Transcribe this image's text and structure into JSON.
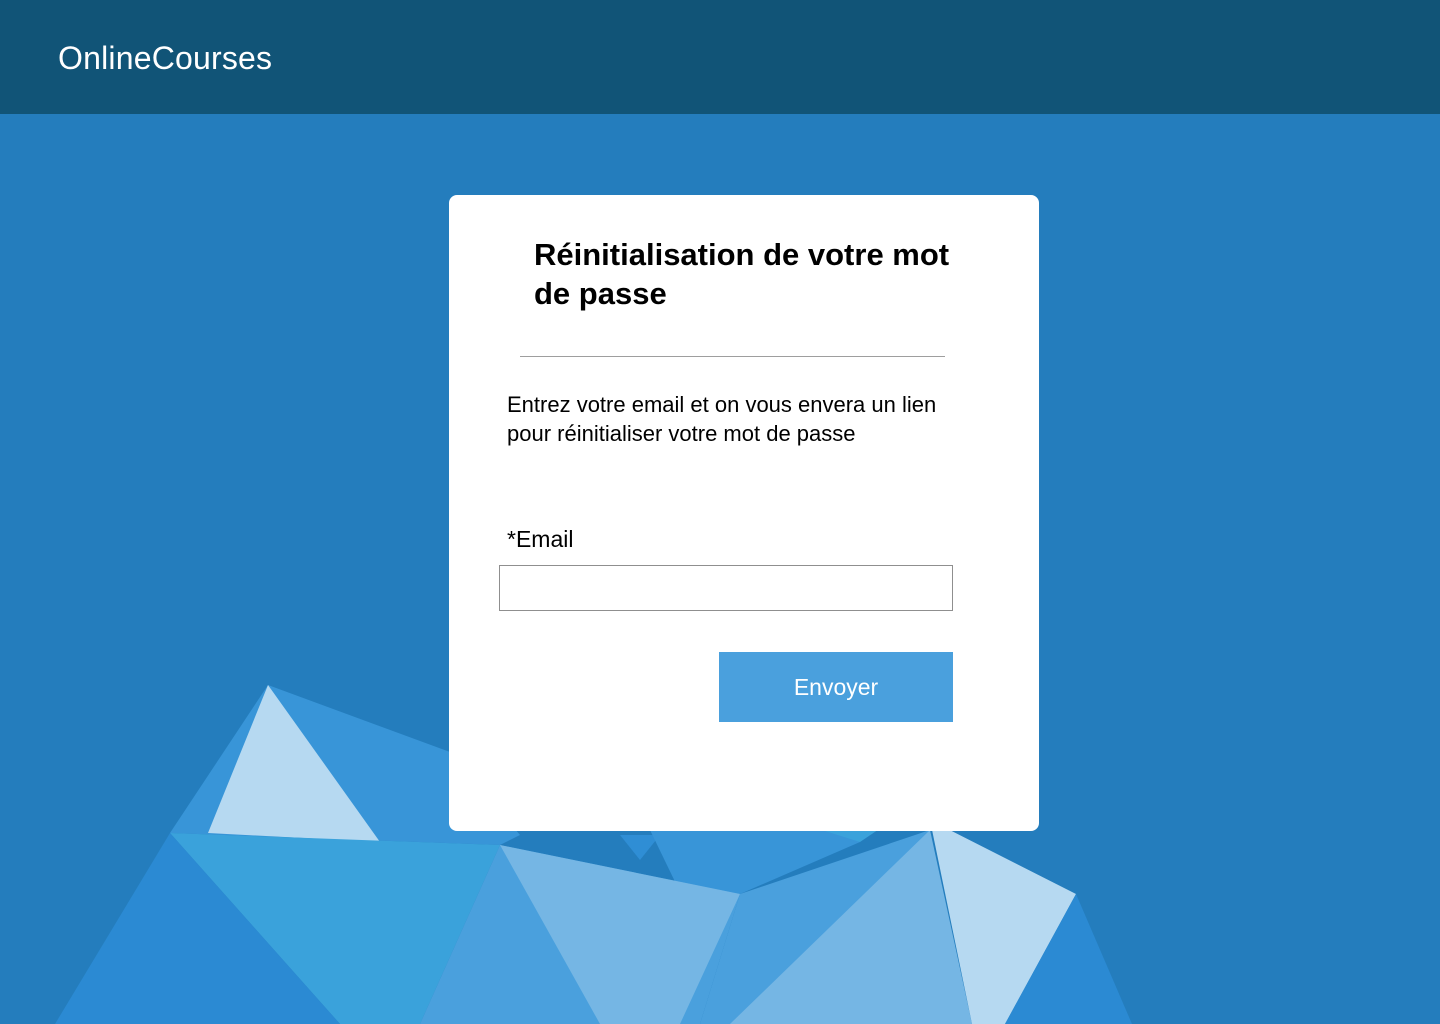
{
  "header": {
    "brand": "OnlineCourses"
  },
  "reset_card": {
    "title": "Réinitialisation de votre mot de passe",
    "description": "Entrez votre email et on vous envera un lien pour réinitialiser votre mot de passe",
    "email_label": "*Email",
    "email_value": "",
    "email_placeholder": "",
    "submit_label": "Envoyer"
  },
  "colors": {
    "header_background": "#115477",
    "page_background": "#247dbd",
    "button_background": "#4aa0dd"
  }
}
